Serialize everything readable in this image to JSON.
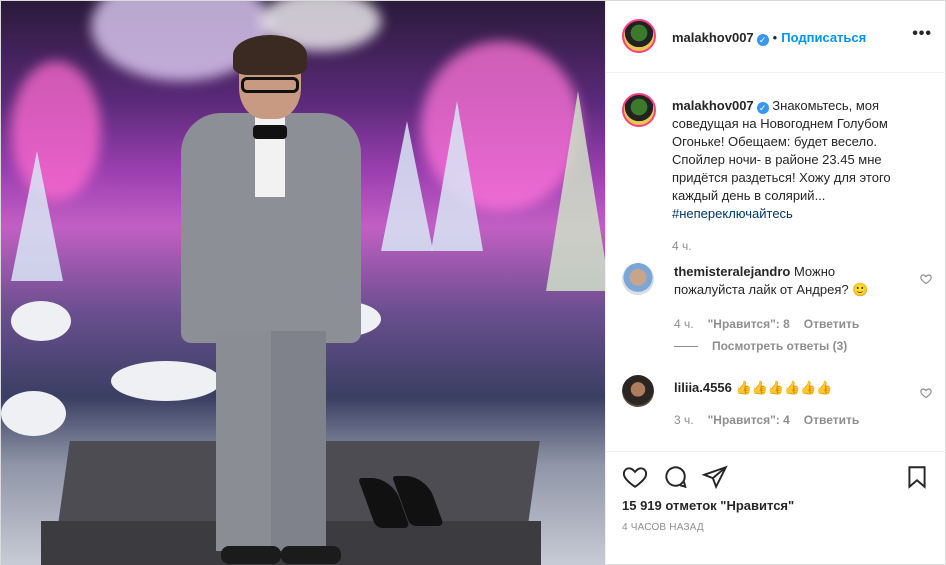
{
  "post": {
    "author": "malakhov007",
    "follow_label": "Подписаться",
    "more_label": "•••"
  },
  "caption": {
    "username": "malakhov007",
    "text": "Знакомьтесь, моя соведущая на Новогоднем Голубом Огоньке! Обещаем: будет весело. Спойлер ночи- в районе 23.45 мне придётся раздеться! Хожу для этого каждый день в солярий...",
    "hashtag": "#непереключайтесь",
    "time": "4 ч."
  },
  "comments": [
    {
      "username": "themisteralejandro",
      "text": "Можно пожалуйста лайк от Андрея? 🙂",
      "time": "4 ч.",
      "likes": "\"Нравится\": 8",
      "reply": "Ответить",
      "view_replies": "Посмотреть ответы (3)"
    },
    {
      "username": "liliia.4556",
      "text": "👍👍👍👍👍👍",
      "time": "3 ч.",
      "likes": "\"Нравится\": 4",
      "reply": "Ответить"
    }
  ],
  "footer": {
    "likes_count": "15 919 отметок \"Нравится\"",
    "posted_ago": "4 ЧАСОВ НАЗАД"
  },
  "icons": {
    "like": "heart-icon",
    "comment": "comment-icon",
    "share": "share-icon",
    "save": "bookmark-icon",
    "verified": "verified-badge-icon"
  },
  "colors": {
    "link": "#0095f6",
    "verified": "#3897f0",
    "muted": "#8e8e8e",
    "text": "#262626"
  }
}
